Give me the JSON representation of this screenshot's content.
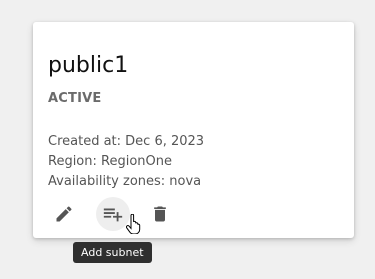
{
  "card": {
    "title": "public1",
    "status": "ACTIVE",
    "created": "Created at: Dec 6, 2023",
    "region": "Region: RegionOne",
    "zones": "Availability zones: nova"
  },
  "actions": [
    {
      "icon": "pencil-icon",
      "name": "edit"
    },
    {
      "icon": "playlist-add-icon",
      "name": "add-subnet"
    },
    {
      "icon": "trash-icon",
      "name": "delete"
    }
  ],
  "tooltip": "Add subnet",
  "colors": {
    "icon": "#555555",
    "tooltip_bg": "#2f2f2f",
    "status": "#6b6b6b"
  }
}
